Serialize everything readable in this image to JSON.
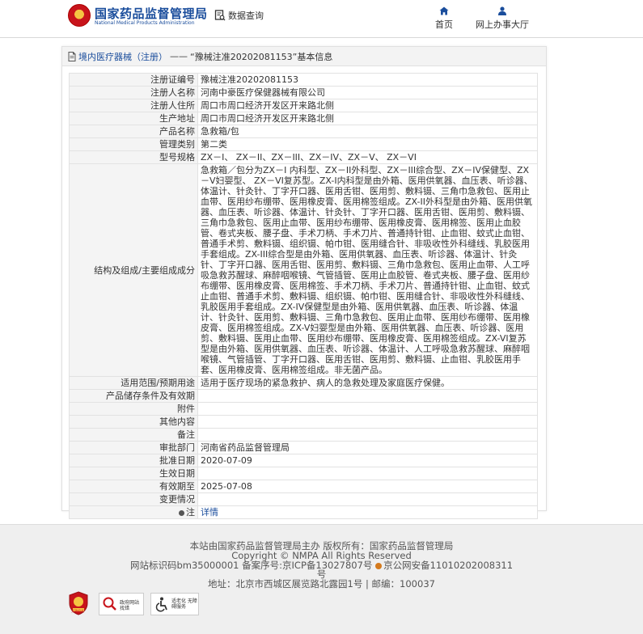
{
  "header": {
    "site_name_cn": "国家药品监督管理局",
    "site_name_en": "National Medical Products Administration",
    "data_query": "数据查询",
    "nav": [
      {
        "label": "首页",
        "icon": "home-icon"
      },
      {
        "label": "网上办事大厅",
        "icon": "user-icon"
      }
    ]
  },
  "breadcrumb": {
    "category": "境内医疗器械（注册）",
    "separator": "——",
    "record_title": "“豫械注准20202081153”基本信息"
  },
  "fields": [
    {
      "label": "注册证编号",
      "value": "豫械注准20202081153"
    },
    {
      "label": "注册人名称",
      "value": "河南中豪医疗保健器械有限公司"
    },
    {
      "label": "注册人住所",
      "value": "周口市周口经济开发区开来路北侧"
    },
    {
      "label": "生产地址",
      "value": "周口市周口经济开发区开来路北侧"
    },
    {
      "label": "产品名称",
      "value": "急救箱/包"
    },
    {
      "label": "管理类别",
      "value": "第二类"
    },
    {
      "label": "型号规格",
      "value": "ZX－I、 ZX－II、ZX－III、ZX－IV、ZX－V、 ZX－VI"
    },
    {
      "label": "结构及组成/主要组成成分",
      "value": "急救箱／包分为ZX－I 内科型、ZX－II外科型、ZX－III综合型、ZX－IV保健型、ZX－V妇婴型、 ZX－VI复苏型。ZX-I内科型是由外箱、医用供氧器、血压表、听诊器、体温计、针灸针、丁字开口器、医用舌钳、医用剪、敷料镊、三角巾急救包、医用止血带、医用纱布绷带、医用橡皮膏、医用棉签组成。ZX-II外科型是由外箱、医用供氧器、血压表、听诊器、体温计、针灸针、丁字开口器、医用舌钳、医用剪、敷料镊、三角巾急救包、医用止血带、医用纱布绷带、医用橡皮膏、医用棉签、医用止血胶管、卷式夹板、腰子盘、手术刀柄、手术刀片、普通持针钳、止血钳、蚊式止血钳、普通手术剪、敷料镊、组织镊、帕巾钳、医用缝合针、非吸收性外科缝线、乳胶医用手套组成。ZX-III综合型是由外箱、医用供氧器、血压表、听诊器、体温计、针灸针、丁字开口器、医用舌钳、医用剪、敷料镊、三角巾急救包、医用止血带、人工呼吸急救苏醒球、麻醉咽喉镜、气管插管、医用止血胶管、卷式夹板、腰子盘、医用纱布绷带、医用橡皮膏、医用棉签、手术刀柄、手术刀片、普通持针钳、止血钳、蚊式止血钳、普通手术剪、敷料镊、组织镊、帕巾钳、医用缝合针、非吸收性外科缝线、乳胶医用手套组成。ZX-IV保健型是由外箱、医用供氧器、血压表、听诊器、体温计、针灸针、医用剪、敷料镊、三角巾急救包、医用止血带、医用纱布绷带、医用橡皮膏、医用棉签组成。ZX-V妇婴型是由外箱、医用供氧器、血压表、听诊器、医用剪、敷料镊、医用止血带、医用纱布绷带、医用橡皮膏、医用棉签组成。ZX-VI复苏型是由外箱、医用供氧器、血压表、听诊器、体温计、人工呼吸急救苏醒球、麻醉咽喉镜、气管插管、丁字开口器、医用舌钳、医用剪、敷料镊、止血钳、乳胶医用手套、医用橡皮膏、医用棉签组成。非无菌产品。"
    },
    {
      "label": "适用范围/预期用途",
      "value": "适用于医疗现场的紧急救护、病人的急救处理及家庭医疗保健。"
    },
    {
      "label": "产品储存条件及有效期",
      "value": ""
    },
    {
      "label": "附件",
      "value": ""
    },
    {
      "label": "其他内容",
      "value": ""
    },
    {
      "label": "备注",
      "value": ""
    },
    {
      "label": "审批部门",
      "value": "河南省药品监督管理局"
    },
    {
      "label": "批准日期",
      "value": "2020-07-09"
    },
    {
      "label": "生效日期",
      "value": ""
    },
    {
      "label": "有效期至",
      "value": "2025-07-08"
    },
    {
      "label": "变更情况",
      "value": ""
    }
  ],
  "note": {
    "label": "注",
    "link": "详情"
  },
  "footer": {
    "line1": "本站由国家药品监督管理局主办 版权所有：国家药品监督管理局",
    "line2": "Copyright © NMPA All Rights Reserved",
    "line3": "网站标识码bm35000001    备案序号:京ICP备13027807号",
    "police": "京公网安备11010202008311",
    "line3b": "号",
    "line4": "地址：北京市西城区展览路北露园1号 | 邮编：100037",
    "badges": [
      {
        "icon": "party-gov-badge-icon",
        "text": "党政机关"
      },
      {
        "icon": "error-report-badge-icon",
        "text": "政府网站 找错"
      },
      {
        "icon": "accessibility-badge-icon",
        "text": "适老化 无障碍服务"
      }
    ]
  }
}
